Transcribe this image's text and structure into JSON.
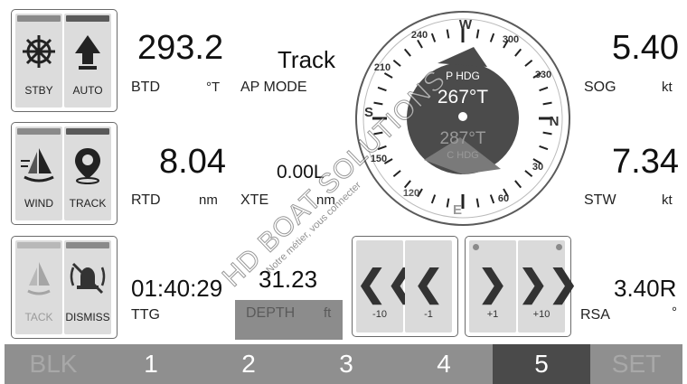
{
  "modes_top": {
    "stby": "STBY",
    "auto": "AUTO"
  },
  "modes_mid": {
    "wind": "WIND",
    "track": "TRACK"
  },
  "modes_bot": {
    "tack": "TACK",
    "dismiss": "DISMISS"
  },
  "btd": {
    "value": "293.2",
    "label": "BTD",
    "unit": "°T"
  },
  "ap_mode": {
    "value": "Track",
    "label": "AP MODE"
  },
  "rtd": {
    "value": "8.04",
    "label": "RTD",
    "unit": "nm"
  },
  "xte": {
    "value": "0.00L",
    "label": "XTE",
    "unit": "nm"
  },
  "ttg": {
    "value": "01:40:29",
    "label": "TTG"
  },
  "depth": {
    "value": "31.23",
    "label": "DEPTH",
    "unit": "ft"
  },
  "sog": {
    "value": "5.40",
    "label": "SOG",
    "unit": "kt"
  },
  "stw": {
    "value": "7.34",
    "label": "STW",
    "unit": "kt"
  },
  "rsa": {
    "value": "3.40R",
    "label": "RSA",
    "unit": "°"
  },
  "compass": {
    "phdg_label": "P HDG",
    "phdg_value": "267°T",
    "second_value": "287°T",
    "second_label": "C HDG",
    "cardinals": {
      "w": "W",
      "n": "N",
      "e": "E",
      "s": "S"
    },
    "ticks": [
      "240",
      "300",
      "330",
      "30",
      "60",
      "120",
      "150",
      "210"
    ]
  },
  "steer": {
    "left_label_big": "-10",
    "left_label_small": "-1",
    "right_label_small": "+1",
    "right_label_big": "+10"
  },
  "bottom_bar": [
    "BLK",
    "1",
    "2",
    "3",
    "4",
    "5",
    "SET"
  ],
  "watermark": {
    "main": "HD BOAT SOLUTIONS",
    "sub": "Notre métier, vous connecter"
  },
  "colors": {
    "bar_bg": "#8f8f8f",
    "bar_active": "#4a4a4a",
    "compass_disc": "#4b4b4b",
    "button_bg": "#dcdcdc"
  }
}
